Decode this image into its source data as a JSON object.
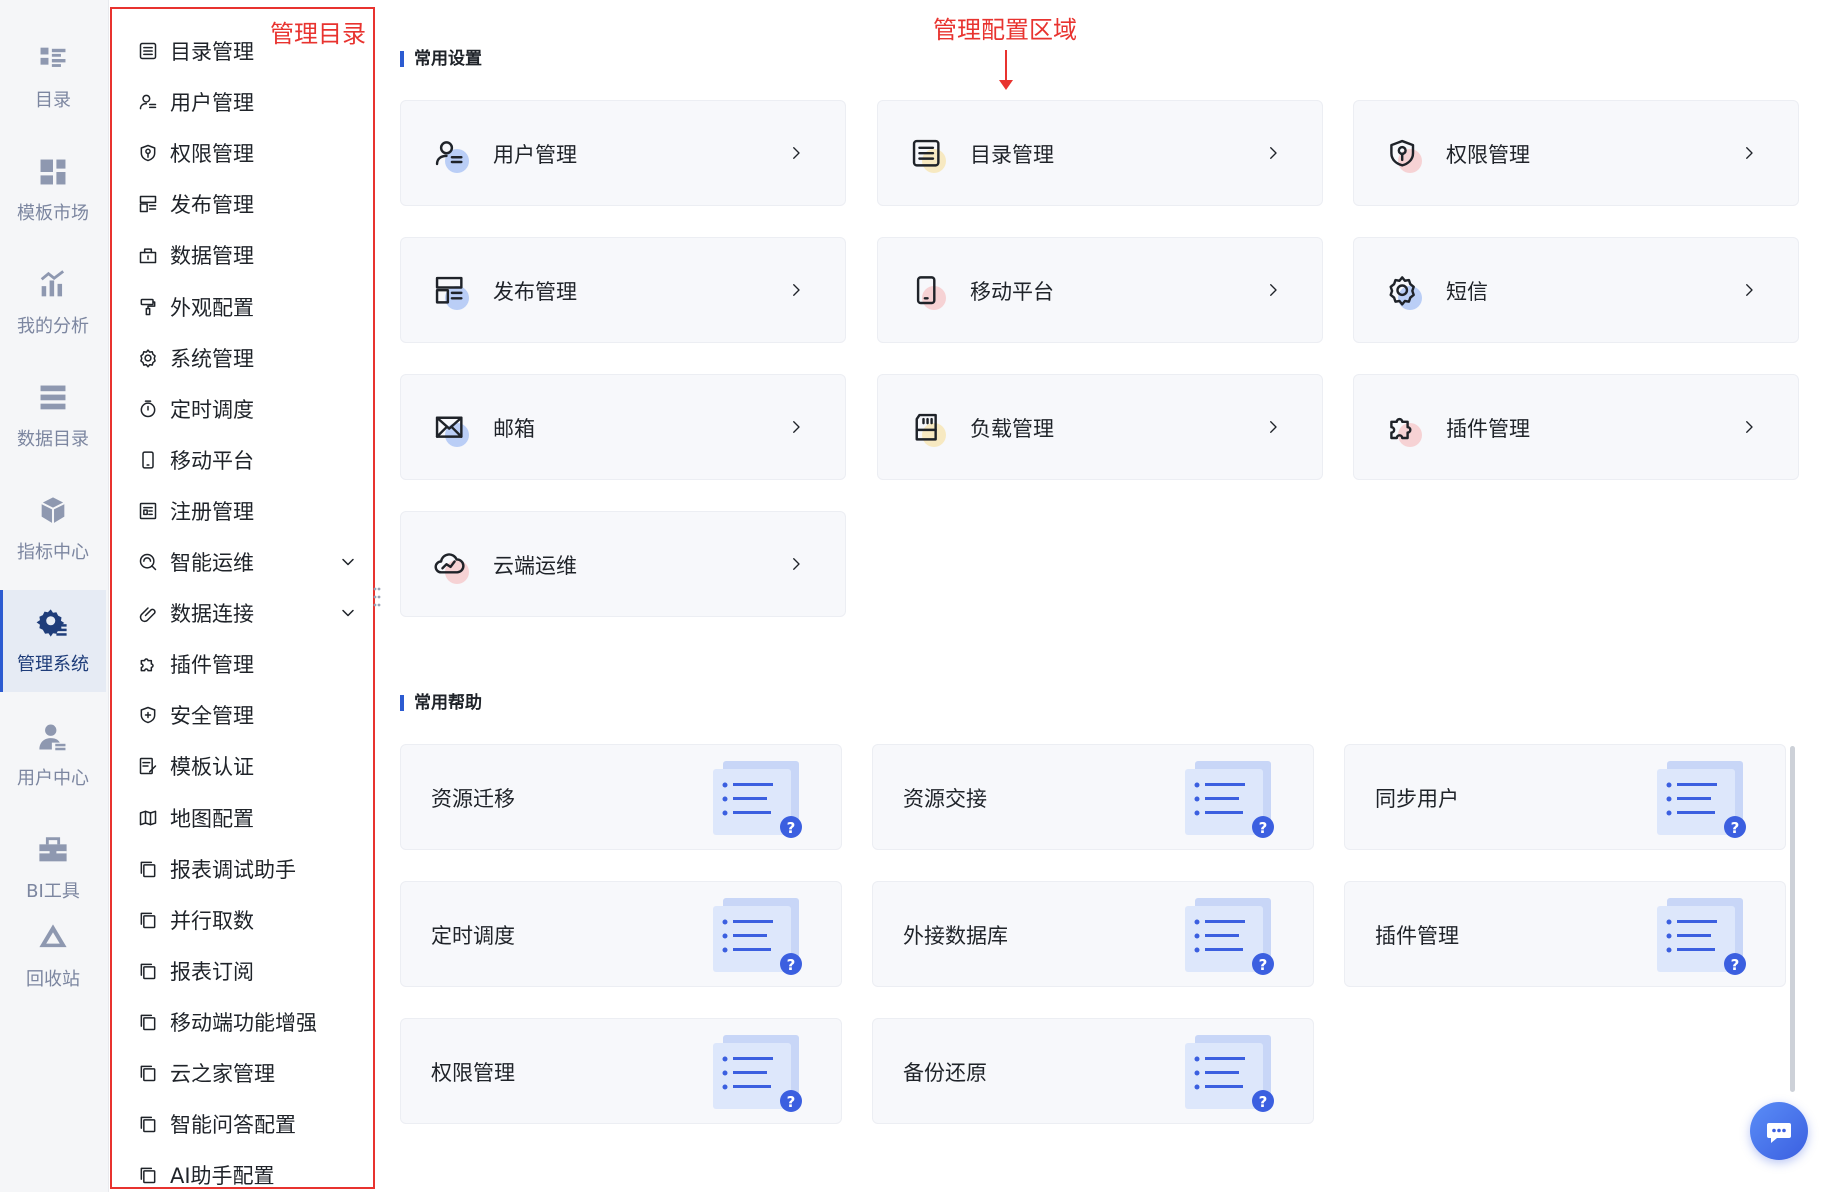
{
  "rail": [
    {
      "label": "目录",
      "icon": "catalog-icon"
    },
    {
      "label": "模板市场",
      "icon": "template-market-icon"
    },
    {
      "label": "我的分析",
      "icon": "analysis-icon"
    },
    {
      "label": "数据目录",
      "icon": "data-catalog-icon"
    },
    {
      "label": "指标中心",
      "icon": "metrics-icon"
    },
    {
      "label": "管理系统",
      "icon": "management-gear-icon",
      "active": true
    },
    {
      "label": "用户中心",
      "icon": "user-center-icon"
    },
    {
      "label": "BI工具",
      "icon": "toolbox-icon"
    },
    {
      "label": "回收站",
      "icon": "recycle-icon"
    }
  ],
  "directory": {
    "annotation": "管理目录",
    "items": [
      {
        "label": "目录管理",
        "icon": "list-icon"
      },
      {
        "label": "用户管理",
        "icon": "user-icon"
      },
      {
        "label": "权限管理",
        "icon": "shield-key-icon"
      },
      {
        "label": "发布管理",
        "icon": "publish-icon"
      },
      {
        "label": "数据管理",
        "icon": "data-box-icon"
      },
      {
        "label": "外观配置",
        "icon": "paint-roller-icon"
      },
      {
        "label": "系统管理",
        "icon": "gear-icon"
      },
      {
        "label": "定时调度",
        "icon": "stopwatch-icon"
      },
      {
        "label": "移动平台",
        "icon": "mobile-icon"
      },
      {
        "label": "注册管理",
        "icon": "register-icon"
      },
      {
        "label": "智能运维",
        "icon": "ops-icon",
        "expandable": true
      },
      {
        "label": "数据连接",
        "icon": "link-clip-icon",
        "expandable": true
      },
      {
        "label": "插件管理",
        "icon": "puzzle-icon"
      },
      {
        "label": "安全管理",
        "icon": "shield-plus-icon"
      },
      {
        "label": "模板认证",
        "icon": "certify-icon"
      },
      {
        "label": "地图配置",
        "icon": "map-icon"
      },
      {
        "label": "报表调试助手",
        "icon": "copy-icon"
      },
      {
        "label": "并行取数",
        "icon": "copy-icon"
      },
      {
        "label": "报表订阅",
        "icon": "copy-icon"
      },
      {
        "label": "移动端功能增强",
        "icon": "copy-icon"
      },
      {
        "label": "云之家管理",
        "icon": "copy-icon"
      },
      {
        "label": "智能问答配置",
        "icon": "copy-icon"
      },
      {
        "label": "AI助手配置",
        "icon": "copy-icon"
      }
    ]
  },
  "main": {
    "annotation": "管理配置区域",
    "settings_title": "常用设置",
    "settings": [
      {
        "label": "用户管理",
        "icon": "user-icon",
        "accent": "#6f9cf0"
      },
      {
        "label": "目录管理",
        "icon": "list-icon",
        "accent": "#f7d77a"
      },
      {
        "label": "权限管理",
        "icon": "shield-key-icon",
        "accent": "#f5a3a3"
      },
      {
        "label": "发布管理",
        "icon": "publish-icon",
        "accent": "#6f9cf0"
      },
      {
        "label": "移动平台",
        "icon": "mobile-icon",
        "accent": "#f5a3a3"
      },
      {
        "label": "短信",
        "icon": "gear-icon",
        "accent": "#6f9cf0"
      },
      {
        "label": "邮箱",
        "icon": "mail-icon",
        "accent": "#6f9cf0"
      },
      {
        "label": "负载管理",
        "icon": "sd-card-icon",
        "accent": "#f7d77a"
      },
      {
        "label": "插件管理",
        "icon": "puzzle-icon",
        "accent": "#f5a3a3"
      },
      {
        "label": "云端运维",
        "icon": "cloud-ops-icon",
        "accent": "#f5a3a3"
      }
    ],
    "help_title": "常用帮助",
    "help": [
      {
        "label": "资源迁移"
      },
      {
        "label": "资源交接"
      },
      {
        "label": "同步用户"
      },
      {
        "label": "定时调度"
      },
      {
        "label": "外接数据库"
      },
      {
        "label": "插件管理"
      },
      {
        "label": "权限管理"
      },
      {
        "label": "备份还原"
      }
    ]
  },
  "colors": {
    "accent": "#2c5bd1",
    "annotation": "#e8332f",
    "card_bg": "#f7f8fb"
  }
}
